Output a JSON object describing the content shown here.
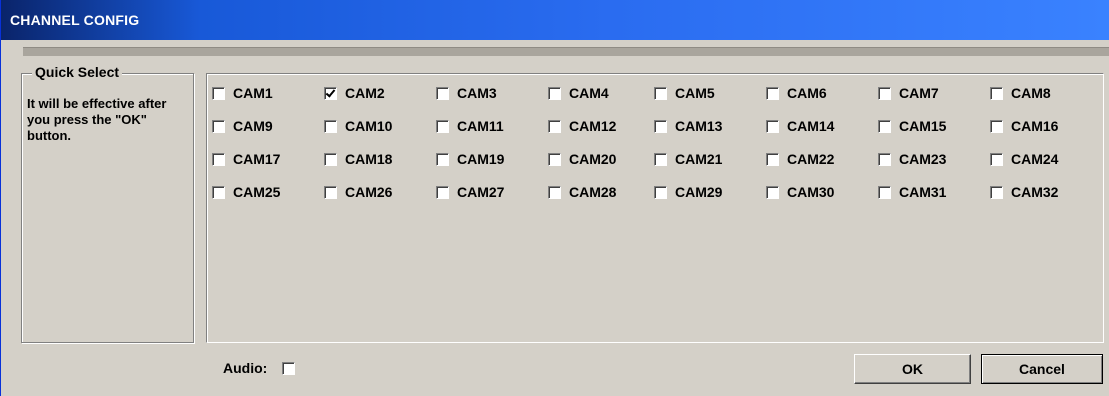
{
  "window": {
    "title": "CHANNEL CONFIG"
  },
  "quick_select": {
    "legend": "Quick Select",
    "text": "It will be effective after you press the \"OK\" button."
  },
  "cameras": [
    {
      "label": "CAM1",
      "checked": false
    },
    {
      "label": "CAM2",
      "checked": true
    },
    {
      "label": "CAM3",
      "checked": false
    },
    {
      "label": "CAM4",
      "checked": false
    },
    {
      "label": "CAM5",
      "checked": false
    },
    {
      "label": "CAM6",
      "checked": false
    },
    {
      "label": "CAM7",
      "checked": false
    },
    {
      "label": "CAM8",
      "checked": false
    },
    {
      "label": "CAM9",
      "checked": false
    },
    {
      "label": "CAM10",
      "checked": false
    },
    {
      "label": "CAM11",
      "checked": false
    },
    {
      "label": "CAM12",
      "checked": false
    },
    {
      "label": "CAM13",
      "checked": false
    },
    {
      "label": "CAM14",
      "checked": false
    },
    {
      "label": "CAM15",
      "checked": false
    },
    {
      "label": "CAM16",
      "checked": false
    },
    {
      "label": "CAM17",
      "checked": false
    },
    {
      "label": "CAM18",
      "checked": false
    },
    {
      "label": "CAM19",
      "checked": false
    },
    {
      "label": "CAM20",
      "checked": false
    },
    {
      "label": "CAM21",
      "checked": false
    },
    {
      "label": "CAM22",
      "checked": false
    },
    {
      "label": "CAM23",
      "checked": false
    },
    {
      "label": "CAM24",
      "checked": false
    },
    {
      "label": "CAM25",
      "checked": false
    },
    {
      "label": "CAM26",
      "checked": false
    },
    {
      "label": "CAM27",
      "checked": false
    },
    {
      "label": "CAM28",
      "checked": false
    },
    {
      "label": "CAM29",
      "checked": false
    },
    {
      "label": "CAM30",
      "checked": false
    },
    {
      "label": "CAM31",
      "checked": false
    },
    {
      "label": "CAM32",
      "checked": false
    }
  ],
  "audio": {
    "label": "Audio:",
    "checked": false
  },
  "buttons": {
    "ok": "OK",
    "cancel": "Cancel"
  }
}
